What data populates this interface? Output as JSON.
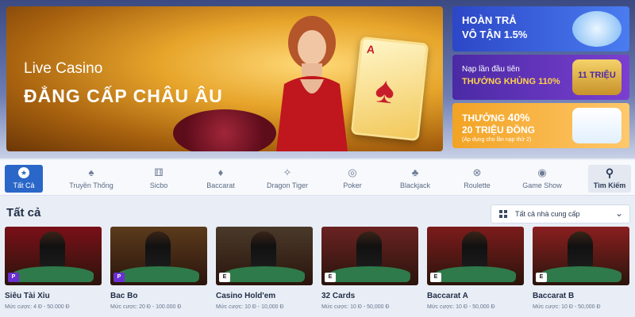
{
  "hero": {
    "title": "Live Casino",
    "subtitle": "ĐẲNG CẤP CHÂU ÂU"
  },
  "promos": [
    {
      "line1": "HOÀN TRẢ",
      "line2": "VÔ TẬN 1.5%"
    },
    {
      "line1": "Nạp lần đầu tiên",
      "line2": "THƯỞNG KHỦNG 110%",
      "deco": "11 TRIỆU"
    },
    {
      "line1_prefix": "THƯỞNG",
      "line1_big": "40%",
      "line2": "20 TRIỆU ĐỒNG",
      "line3": "(Áp dụng cho lần nạp thứ 2)"
    }
  ],
  "categories": [
    {
      "label": "Tất Cả",
      "icon": "star-icon",
      "active": true
    },
    {
      "label": "Truyền Thống",
      "icon": "cards-icon"
    },
    {
      "label": "Sicbo",
      "icon": "dice-icon"
    },
    {
      "label": "Baccarat",
      "icon": "baccarat-icon"
    },
    {
      "label": "Dragon Tiger",
      "icon": "dragon-icon"
    },
    {
      "label": "Poker",
      "icon": "poker-chip-icon"
    },
    {
      "label": "Blackjack",
      "icon": "blackjack-icon"
    },
    {
      "label": "Roulette",
      "icon": "roulette-icon"
    },
    {
      "label": "Game Show",
      "icon": "game-show-icon"
    }
  ],
  "search": {
    "label": "Tìm Kiếm",
    "icon": "search-icon"
  },
  "section": {
    "title": "Tất cả",
    "provider_label": "Tất cả nhà cung cấp"
  },
  "games": [
    {
      "name": "Siêu Tài Xỉu",
      "bet": "Mức cược: 4 Đ - 50.000 Đ",
      "badge": "P",
      "bg": "#7a1018"
    },
    {
      "name": "Bac Bo",
      "bet": "Mức cược: 20 Đ - 100.000 Đ",
      "badge": "P",
      "bg": "#5b3b1c"
    },
    {
      "name": "Casino Hold'em",
      "bet": "Mức cược: 10 Đ - 10,000 Đ",
      "badge": "E",
      "bg": "#4a3a2a"
    },
    {
      "name": "32 Cards",
      "bet": "Mức cược: 10 Đ - 50,000 Đ",
      "badge": "E",
      "bg": "#6a2222"
    },
    {
      "name": "Baccarat A",
      "bet": "Mức cược: 10 Đ - 50,000 Đ",
      "badge": "E",
      "bg": "#7c1b1b"
    },
    {
      "name": "Baccarat B",
      "bet": "Mức cược: 10 Đ - 50,000 Đ",
      "badge": "E",
      "bg": "#8a1f1f"
    }
  ]
}
